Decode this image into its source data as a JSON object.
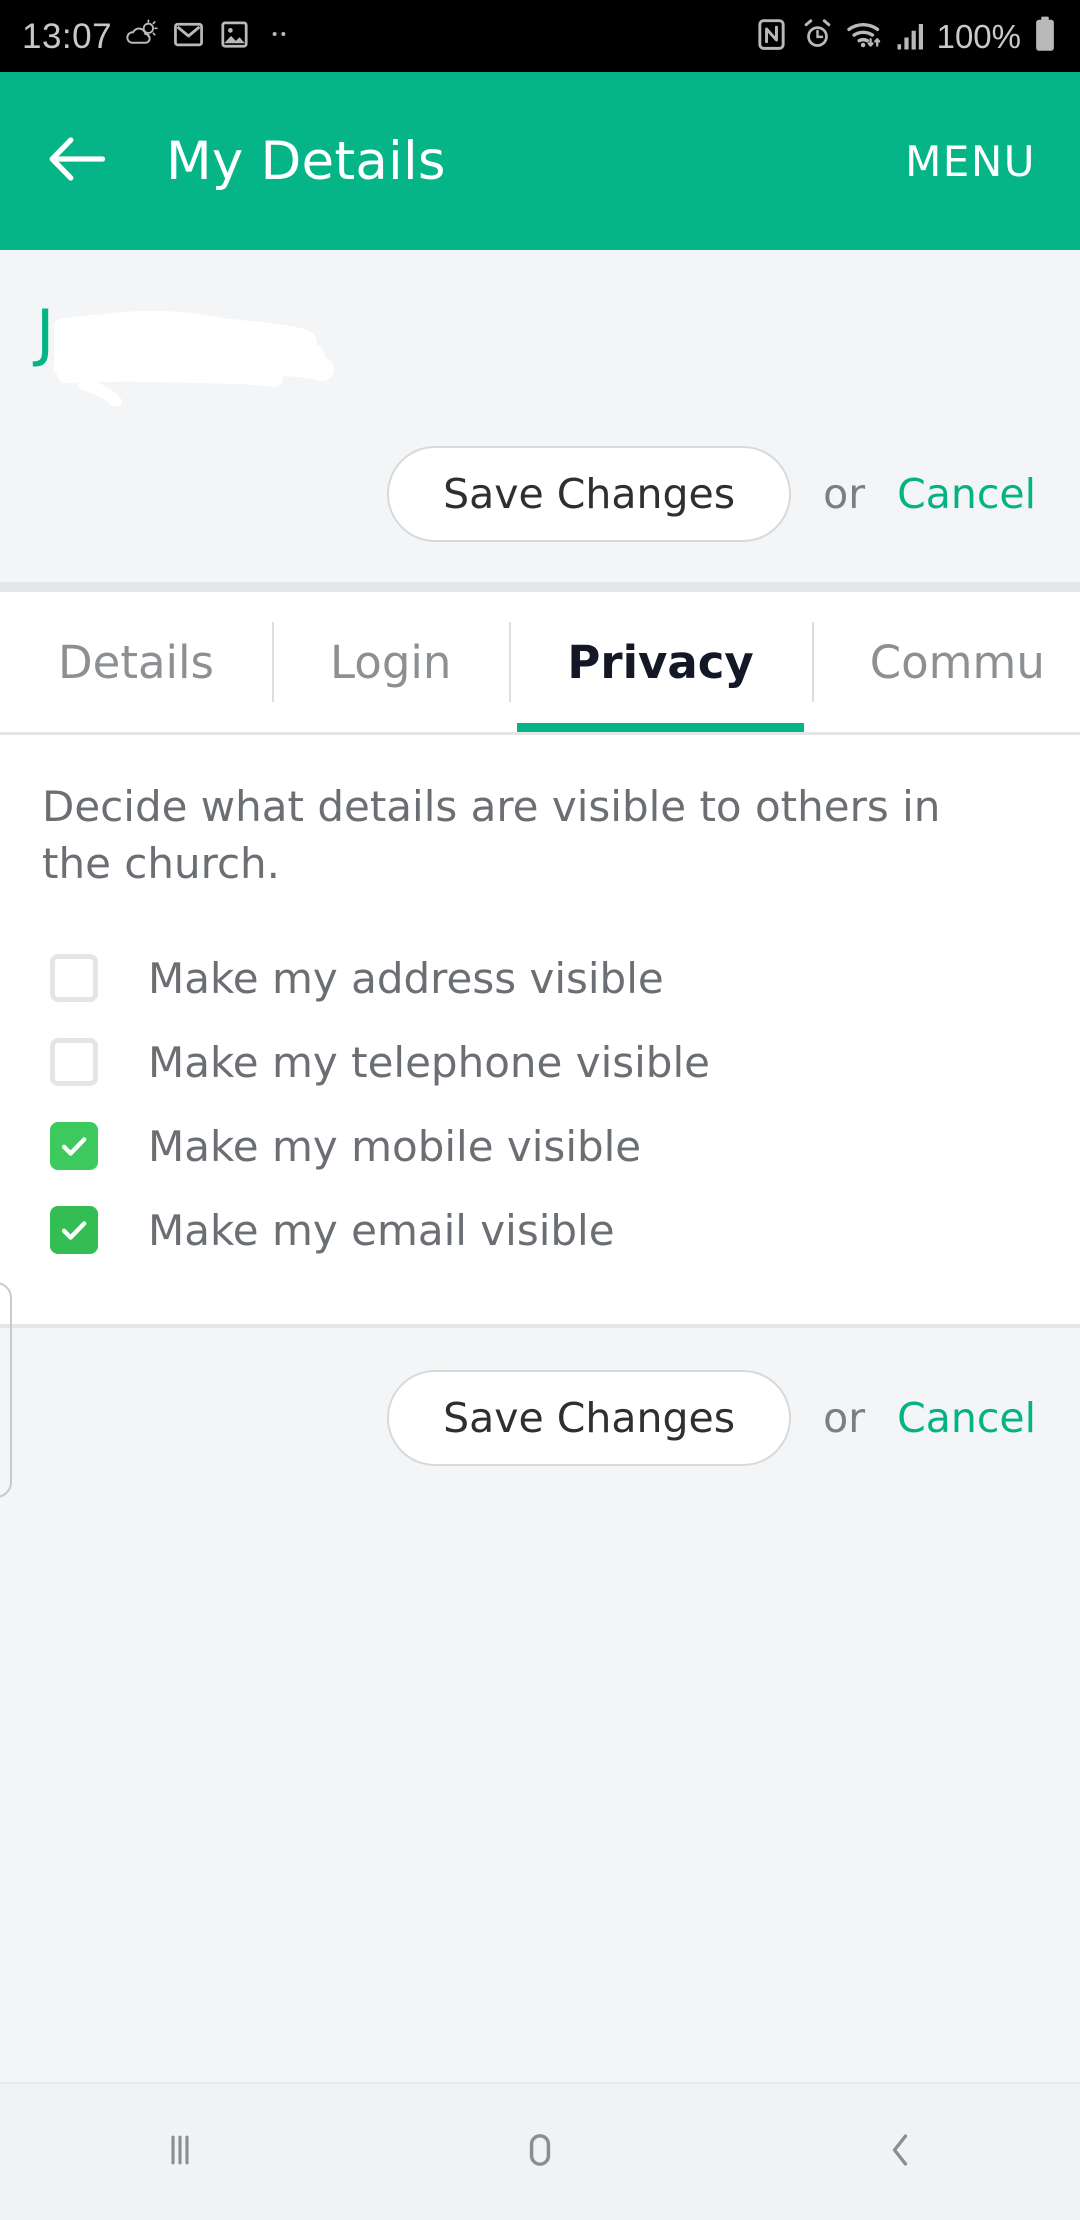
{
  "statusbar": {
    "time": "13:07",
    "battery_percent": "100%",
    "left_icons": [
      "weather-partly-cloudy-icon",
      "gmail-icon",
      "photos-icon",
      "more-dots-icon"
    ],
    "right_icons": [
      "nfc-icon",
      "alarm-icon",
      "wifi-icon",
      "cellular-signal-icon",
      "battery-icon"
    ]
  },
  "appbar": {
    "back_icon": "arrow-left-icon",
    "title": "My Details",
    "menu_label": "MENU",
    "background_color": "#05B587"
  },
  "profile": {
    "initial": "J",
    "redacted": true
  },
  "actions": {
    "save_label": "Save Changes",
    "or_label": "or",
    "cancel_label": "Cancel",
    "cancel_color": "#04B383"
  },
  "tabs": {
    "items": [
      {
        "label": "Details",
        "active": false
      },
      {
        "label": "Login",
        "active": false
      },
      {
        "label": "Privacy",
        "active": true
      },
      {
        "label": "Commu",
        "active": false
      }
    ],
    "active_indicator_color": "#05B587"
  },
  "privacy": {
    "description": "Decide what details are visible to others in the church.",
    "options": [
      {
        "label": "Make my address visible",
        "checked": false
      },
      {
        "label": "Make my telephone visible",
        "checked": false
      },
      {
        "label": "Make my mobile visible",
        "checked": true
      },
      {
        "label": "Make my email visible",
        "checked": true
      }
    ],
    "checked_color": "#3DC95D"
  },
  "navbar": {
    "recents_icon": "recents-icon",
    "home_icon": "home-icon",
    "back_icon": "back-chevron-icon"
  }
}
